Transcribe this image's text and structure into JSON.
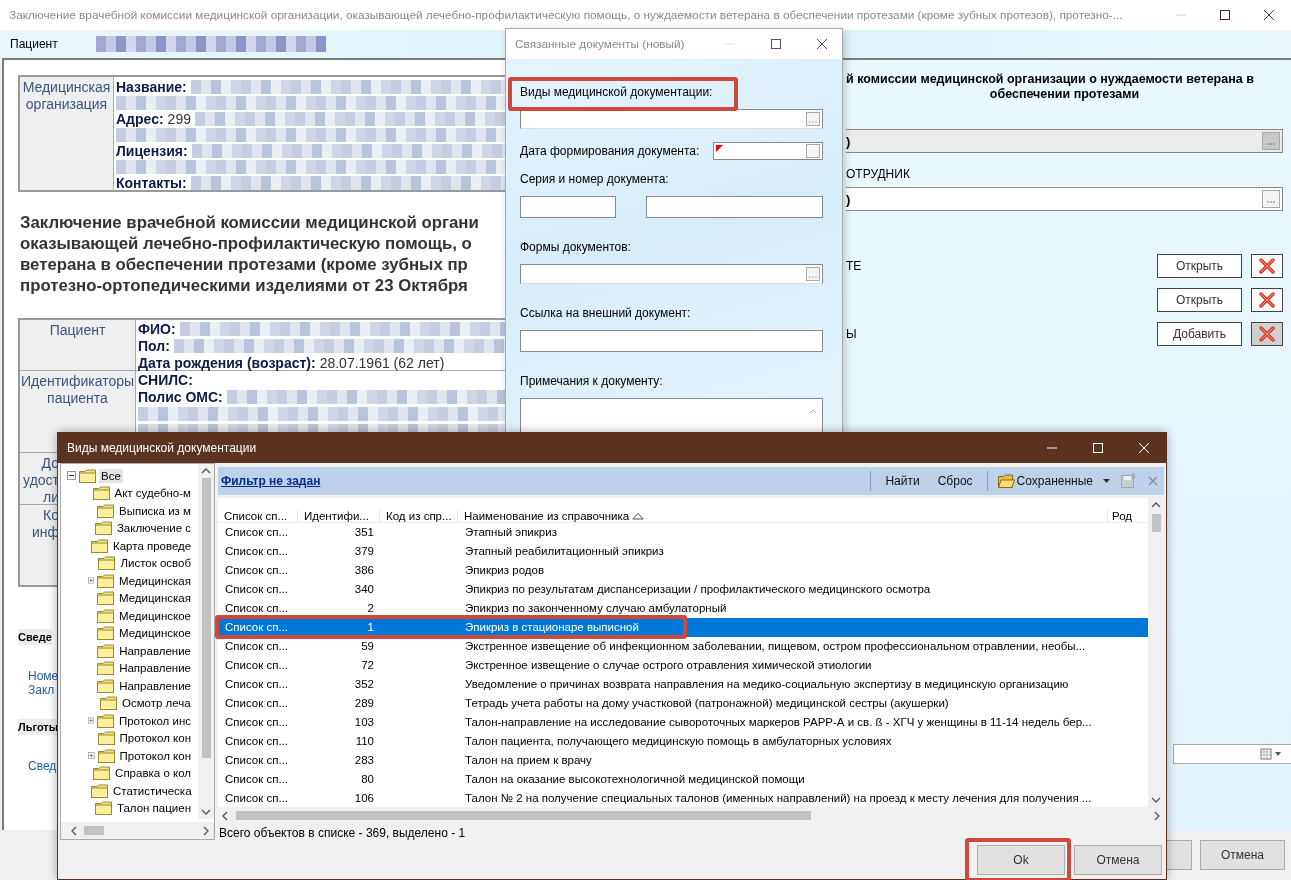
{
  "main_window": {
    "title": "Заключение врачебной комиссии медицинской организации, оказывающей лечебно-профилактическую помощь, о нуждаемости ветерана в обеспечении протезами (кроме зубных протезов), протезно-...",
    "patient_label": "Пациент",
    "org_table": {
      "header": [
        "Медицинская",
        "организация"
      ],
      "lines": [
        {
          "label": "Название:"
        },
        {
          "label": "Адрес:",
          "value": "299"
        },
        {
          "label": "Лицензия:"
        },
        {
          "label": "Контакты:"
        }
      ]
    },
    "heading_lines": [
      "Заключение врачебной комиссии медицинской органи",
      "оказывающей лечебно-профилактическую помощь, о",
      "ветерана в обеспечении протезами (кроме зубных пр",
      "протезно-ортопедическими изделиями от 23 Октября"
    ],
    "patient_table": [
      {
        "header": [
          "Пациент"
        ],
        "lines": [
          {
            "label": "ФИО:"
          },
          {
            "label": "Пол:"
          },
          {
            "label": "Дата рождения (возраст):",
            "value": "28.07.1961 (62 лет)"
          }
        ]
      },
      {
        "header": [
          "Идентификаторы",
          "пациента"
        ],
        "lines": [
          {
            "label": "СНИЛС:"
          },
          {
            "label": "Полис ОМС:"
          }
        ]
      },
      {
        "header": [
          "До",
          "удост",
          "ли"
        ]
      },
      {
        "header": [
          "Ко",
          "инф"
        ]
      }
    ],
    "sections": [
      {
        "kind": "header",
        "text": "Сведе"
      },
      {
        "kind": "link",
        "text": "Номе"
      },
      {
        "kind": "link",
        "text": "Закл"
      },
      {
        "kind": "header",
        "text": "Льготы"
      },
      {
        "kind": "link",
        "text": "Свед"
      }
    ],
    "right_panel": {
      "heading_lines": [
        "й комиссии медицинской организации о нуждаемости ветерана в",
        "обеспечении протезами"
      ],
      "fields": [
        {
          "value": ")",
          "disabled": true
        },
        {
          "label": "ОТРУДНИК",
          "value": ")",
          "disabled": false
        }
      ],
      "doc_rows": [
        {
          "label": "ТЕ",
          "button": "Открыть",
          "pressed": false
        },
        {
          "button": "Открыть",
          "pressed": false
        },
        {
          "label": "Ы",
          "button": "Добавить",
          "pressed": true
        }
      ]
    },
    "buttons": [
      "Отмена"
    ]
  },
  "related_dialog": {
    "title": "Связанные документы (новый)",
    "fields": [
      {
        "kind": "lookup",
        "label": "Виды медицинской документации:",
        "highlighted": true
      },
      {
        "kind": "date",
        "label": "Дата формирования документа:",
        "highlighted": false
      },
      {
        "kind": "pair",
        "label": "Серия и номер документа:",
        "highlighted": false
      },
      {
        "kind": "lookup",
        "label": "Формы документов:",
        "highlighted": false
      },
      {
        "kind": "text",
        "label": "Ссылка на внешний документ:",
        "highlighted": false
      },
      {
        "kind": "memo",
        "label": "Примечания к документу:",
        "highlighted": false
      }
    ]
  },
  "types_dialog": {
    "title": "Виды медицинской документации",
    "tree": {
      "label": "Все",
      "expanded": true,
      "selected": true,
      "children": [
        {
          "label": "Акт судебно-м",
          "expandable": false
        },
        {
          "label": "Выписка из м",
          "expandable": false
        },
        {
          "label": "Заключение с",
          "expandable": false
        },
        {
          "label": "Карта проведе",
          "expandable": false
        },
        {
          "label": "Листок освоб",
          "expandable": false
        },
        {
          "label": "Медицинская",
          "expandable": true
        },
        {
          "label": "Медицинская",
          "expandable": false
        },
        {
          "label": "Медицинское",
          "expandable": false
        },
        {
          "label": "Медицинское",
          "expandable": false
        },
        {
          "label": "Направление",
          "expandable": false
        },
        {
          "label": "Направление",
          "expandable": false
        },
        {
          "label": "Направление",
          "expandable": false
        },
        {
          "label": "Осмотр леча",
          "expandable": false
        },
        {
          "label": "Протокол инс",
          "expandable": true
        },
        {
          "label": "Протокол кон",
          "expandable": false
        },
        {
          "label": "Протокол кон",
          "expandable": true
        },
        {
          "label": "Справка о кол",
          "expandable": false
        },
        {
          "label": "Статистическа",
          "expandable": false
        },
        {
          "label": "Талон пациен",
          "expandable": false
        }
      ]
    },
    "filter_link": "Фильтр не задан",
    "toolbar": [
      "Найти",
      "Сброс"
    ],
    "saved_menu": "Сохраненные",
    "columns": [
      {
        "label": "Список сп...",
        "sorted": false
      },
      {
        "label": "Идентифи...",
        "sorted": false
      },
      {
        "label": "Код из спр...",
        "sorted": false
      },
      {
        "label": "Наименование из справочника",
        "sorted": true
      },
      {
        "label": "Род",
        "sorted": false
      }
    ],
    "rows": [
      {
        "list": "Список сп...",
        "id": "351",
        "name": "Этапный эпикриз",
        "selected": false,
        "highlighted": false
      },
      {
        "list": "Список сп...",
        "id": "379",
        "name": "Этапный реабилитационный эпикриз",
        "selected": false,
        "highlighted": false
      },
      {
        "list": "Список сп...",
        "id": "386",
        "name": "Эпикриз родов",
        "selected": false,
        "highlighted": false
      },
      {
        "list": "Список сп...",
        "id": "340",
        "name": "Эпикриз по результатам диспансеризации / профилактического медицинского осмотра",
        "selected": false,
        "highlighted": false
      },
      {
        "list": "Список сп...",
        "id": "2",
        "name": "Эпикриз по законченному случаю амбулаторный",
        "selected": false,
        "highlighted": false
      },
      {
        "list": "Список сп...",
        "id": "1",
        "name": "Эпикриз в стационаре выписной",
        "selected": true,
        "highlighted": true
      },
      {
        "list": "Список сп...",
        "id": "59",
        "name": "Экстренное извещение об инфекционном заболевании, пищевом, остром профессиональном отравлении, необы...",
        "selected": false,
        "highlighted": false
      },
      {
        "list": "Список сп...",
        "id": "72",
        "name": "Экстренное извещение о случае острого отравления химической этиологии",
        "selected": false,
        "highlighted": false
      },
      {
        "list": "Список сп...",
        "id": "352",
        "name": "Уведомление о причинах возврата направления на медико-социальную экспертизу в медицинскую организацию",
        "selected": false,
        "highlighted": false
      },
      {
        "list": "Список сп...",
        "id": "289",
        "name": "Тетрадь учета работы на дому участковой (патронажной) медицинской сестры (акушерки)",
        "selected": false,
        "highlighted": false
      },
      {
        "list": "Список сп...",
        "id": "103",
        "name": "Талон-направление на исследование сывороточных маркеров РАРР-А и св. ß - ХГЧ у женщины в 11-14 недель бер...",
        "selected": false,
        "highlighted": false
      },
      {
        "list": "Список сп...",
        "id": "110",
        "name": "Талон пациента, получающего медицинскую помощь в амбулаторных условиях",
        "selected": false,
        "highlighted": false
      },
      {
        "list": "Список сп...",
        "id": "283",
        "name": "Талон на прием к врачу",
        "selected": false,
        "highlighted": false
      },
      {
        "list": "Список сп...",
        "id": "80",
        "name": "Талон на оказание высокотехнологичной медицинской помощи",
        "selected": false,
        "highlighted": false
      },
      {
        "list": "Список сп...",
        "id": "106",
        "name": "Талон № 2 на получение специальных талонов (именных направлений) на проезд к месту лечения для получения ...",
        "selected": false,
        "highlighted": false
      }
    ],
    "status": "Всего объектов в списке - 369, выделено - 1",
    "buttons": [
      {
        "label": "Ok",
        "highlighted": true
      },
      {
        "label": "Отмена",
        "highlighted": false
      }
    ]
  }
}
